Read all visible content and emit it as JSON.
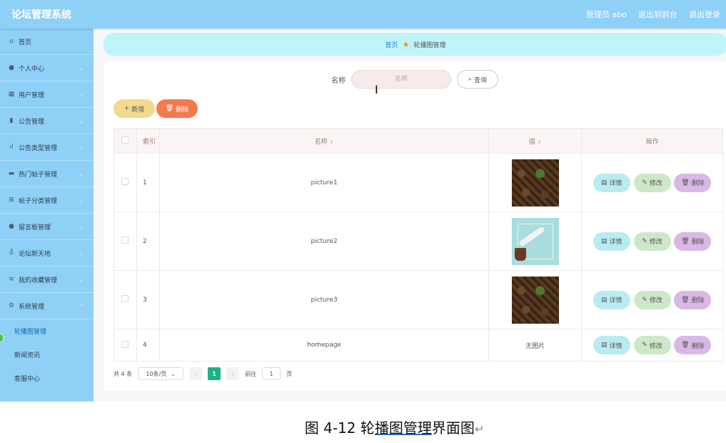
{
  "topbar": {
    "title": "论坛管理系统",
    "user": "管理员 abo",
    "to_front": "退出到前台",
    "logout": "退出登录"
  },
  "sidebar": {
    "items": [
      {
        "icon": "home-icon",
        "label": "首页"
      },
      {
        "icon": "person-icon",
        "label": "个人中心"
      },
      {
        "icon": "users-icon",
        "label": "用户管理"
      },
      {
        "icon": "notice-icon",
        "label": "公告管理"
      },
      {
        "icon": "bar-chart-icon",
        "label": "公告类型管理"
      },
      {
        "icon": "hot-post-icon",
        "label": "热门帖子管理"
      },
      {
        "icon": "grid-icon",
        "label": "帖子分类管理"
      },
      {
        "icon": "message-icon",
        "label": "留言板管理"
      },
      {
        "icon": "mic-icon",
        "label": "论坛新天地"
      },
      {
        "icon": "list-icon",
        "label": "我的收藏管理"
      },
      {
        "icon": "settings-icon",
        "label": "系统管理"
      }
    ],
    "sub_items": [
      "轮播图管理",
      "新闻资讯",
      "客服中心"
    ]
  },
  "breadcrumb": {
    "home": "首页",
    "current": "轮播图管理"
  },
  "search": {
    "label": "名称",
    "placeholder": "名称",
    "button": "查询"
  },
  "actions": {
    "add": "新增",
    "delete": "删除"
  },
  "table": {
    "headers": {
      "index": "索引",
      "name": "名称",
      "value": "值",
      "ops": "操作"
    },
    "rows": [
      {
        "index": "1",
        "name": "picture1",
        "value": ""
      },
      {
        "index": "2",
        "name": "picture2",
        "value": ""
      },
      {
        "index": "3",
        "name": "picture3",
        "value": ""
      },
      {
        "index": "4",
        "name": "homepage",
        "value": "无图片"
      }
    ],
    "op_labels": {
      "detail": "详情",
      "edit": "修改",
      "delete": "删除"
    }
  },
  "pager": {
    "total": "共 4 条",
    "size": "10条/页",
    "current": "1",
    "goto_label": "前往",
    "goto_value": "1",
    "page_unit": "页"
  },
  "caption": {
    "prefix": "图 4-12 轮",
    "underlined": "播图管理",
    "suffix": "界面图"
  }
}
